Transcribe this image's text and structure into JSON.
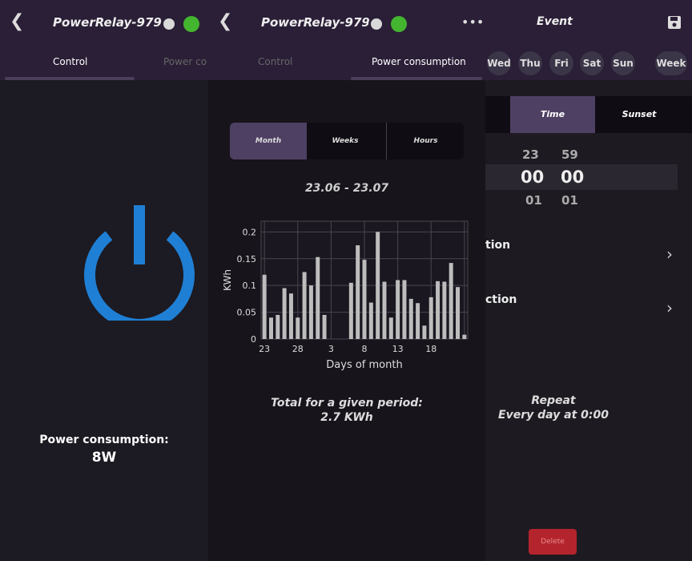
{
  "left_panel": {
    "title": "PowerRelay-979c",
    "tabs": [
      "Control",
      "Power co"
    ],
    "power_label": "Power consumption:",
    "power_value": "8W"
  },
  "middle_panel": {
    "title": "PowerRelay-979c",
    "tabs": [
      "Control",
      "Power consumption"
    ],
    "segments": [
      "Month",
      "Weeks",
      "Hours"
    ],
    "range": "23.06 - 23.07",
    "total_label": "Total for a given period:",
    "total_value": "2.7 KWh"
  },
  "right_panel": {
    "title": "Event",
    "days": [
      "Wed",
      "Thu",
      "Fri",
      "Sat",
      "Sun",
      "Week"
    ],
    "modes": [
      "Time",
      "Sunset"
    ],
    "picker": {
      "hours": [
        "23",
        "00",
        "01"
      ],
      "minutes": [
        "59",
        "00",
        "01"
      ]
    },
    "rows": [
      "tion",
      "ction"
    ],
    "repeat_title": "Repeat",
    "repeat_value": "Every day at 0:00",
    "delete_label": "Delete"
  },
  "chart_data": {
    "type": "bar",
    "xlabel": "Days of month",
    "ylabel": "KWh",
    "ylim": [
      0,
      0.22
    ],
    "y_ticks": [
      0,
      0.05,
      0.1,
      0.15,
      0.2
    ],
    "x_tick_labels": [
      "23",
      "28",
      "3",
      "8",
      "13",
      "18"
    ],
    "values": [
      0.12,
      0.04,
      0.045,
      0.095,
      0.085,
      0.04,
      0.125,
      0.1,
      0.153,
      0.045,
      0,
      0,
      0,
      0.105,
      0.175,
      0.148,
      0.068,
      0.2,
      0.107,
      0.04,
      0.11,
      0.11,
      0.075,
      0.067,
      0.025,
      0.078,
      0.108,
      0.107,
      0.142,
      0.097,
      0.008
    ],
    "colors": {
      "bar": "#bdbdbd",
      "grid": "#4a4650",
      "plot_bg": "#1a1720"
    }
  }
}
